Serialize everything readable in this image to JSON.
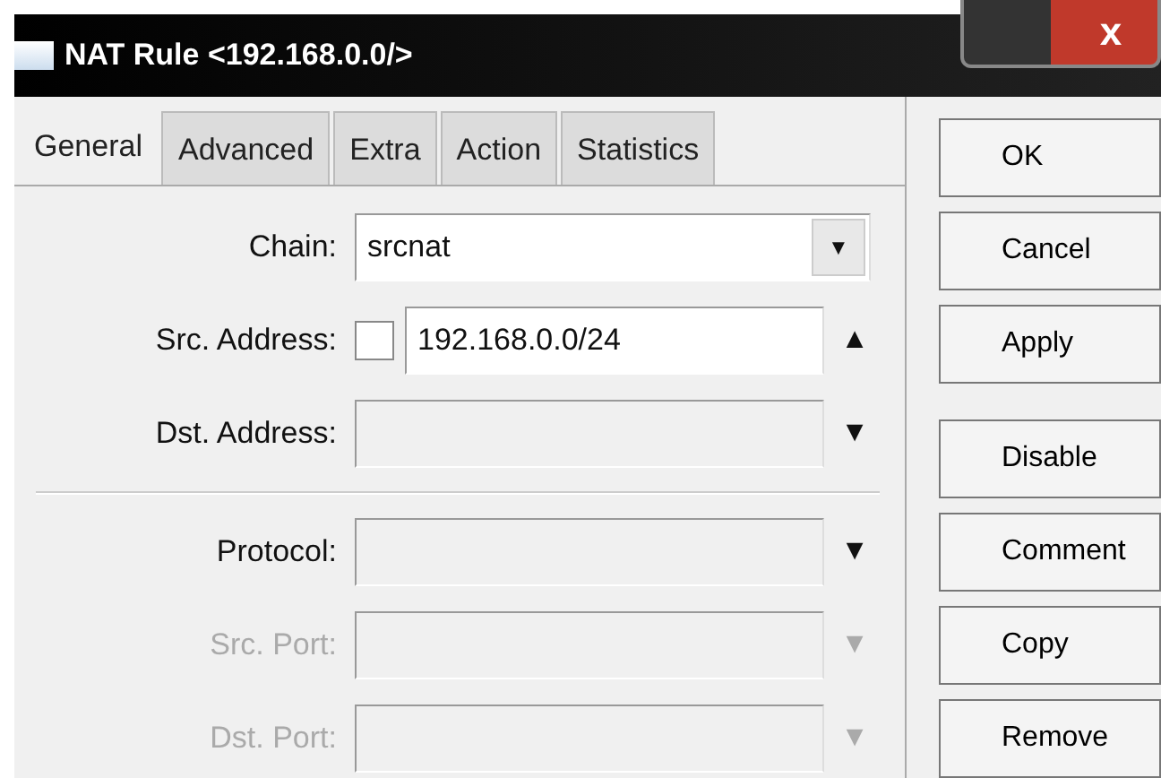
{
  "window": {
    "title": "NAT Rule <192.168.0.0/>",
    "close": "x"
  },
  "tabs": [
    {
      "label": "General",
      "selected": true
    },
    {
      "label": "Advanced",
      "selected": false
    },
    {
      "label": "Extra",
      "selected": false
    },
    {
      "label": "Action",
      "selected": false
    },
    {
      "label": "Statistics",
      "selected": false
    }
  ],
  "field_groups": [
    [
      {
        "kind": "combo",
        "label": "Chain:",
        "value": "srcnat",
        "disabled": false,
        "button": "▼"
      },
      {
        "kind": "negatable",
        "label": "Src. Address:",
        "value": "192.168.0.0/24",
        "checked": false,
        "disabled": false,
        "arrow": "▲"
      },
      {
        "kind": "plain",
        "label": "Dst. Address:",
        "disabled": false,
        "arrow": "▼"
      }
    ],
    [
      {
        "kind": "plain",
        "label": "Protocol:",
        "disabled": false,
        "arrow": "▼"
      },
      {
        "kind": "plain",
        "label": "Src. Port:",
        "disabled": true,
        "arrow": "▼"
      },
      {
        "kind": "plain",
        "label": "Dst. Port:",
        "disabled": true,
        "arrow": "▼"
      }
    ]
  ],
  "button_groups": [
    [
      "OK",
      "Cancel",
      "Apply"
    ],
    [
      "Disable",
      "Comment",
      "Copy",
      "Remove"
    ]
  ]
}
